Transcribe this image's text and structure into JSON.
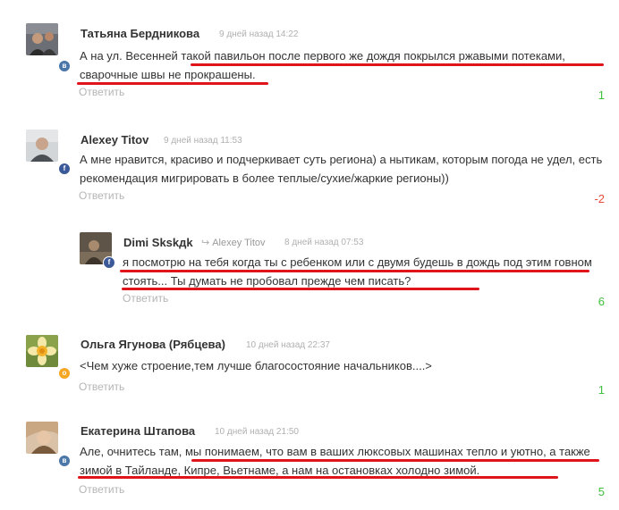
{
  "comments": [
    {
      "author": "Татьяна Бердникова",
      "time": "9 дней назад 14:22",
      "text": "А на ул. Весенней такой павильон после первого же дождя покрылся ржавыми потеками, сварочные швы не прокрашены.",
      "reply_label": "Ответить",
      "score": "1",
      "network": "vk",
      "network_badge": "в",
      "score_color": "#3ec13e"
    },
    {
      "author": "Alexey Titov",
      "time": "9 дней назад 11:53",
      "text": "А мне нравится,  красиво и подчеркивает суть региона) а нытикам, которым погода не удел,  есть рекомендация мигрировать в более теплые/сухие/жаркие регионы))",
      "reply_label": "Ответить",
      "score": "-2",
      "network": "fb",
      "network_badge": "f",
      "score_color": "#e84b3c"
    },
    {
      "author": "Dimi Skskдk",
      "reply_to": "Alexey Titov",
      "time": "8 дней назад 07:53",
      "text": "я посмотрю на тебя когда ты с ребенком или с двумя будешь в дождь под этим говном стоять... Ты думать не пробовал прежде чем писать?",
      "reply_label": "Ответить",
      "score": "6",
      "network": "fb",
      "network_badge": "f",
      "score_color": "#3ec13e"
    },
    {
      "author": "Ольга Ягунова (Рябцева)",
      "time": "10 дней назад 22:37",
      "text": "<Чем хуже строение,тем лучше благосостояние начальников....>",
      "reply_label": "Ответить",
      "score": "1",
      "network": "ok",
      "network_badge": "о",
      "score_color": "#3ec13e"
    },
    {
      "author": "Екатерина Штапова",
      "time": "10 дней назад 21:50",
      "text": "Але, очнитесь там, мы понимаем, что вам в ваших люксовых машинах тепло и уютно, а также зимой в Тайланде, Кипре, Вьетнаме, а нам на остановках холодно зимой.",
      "reply_label": "Ответить",
      "score": "5",
      "network": "vk",
      "network_badge": "в",
      "score_color": "#3ec13e"
    }
  ],
  "annotation_color": "#e0141b"
}
